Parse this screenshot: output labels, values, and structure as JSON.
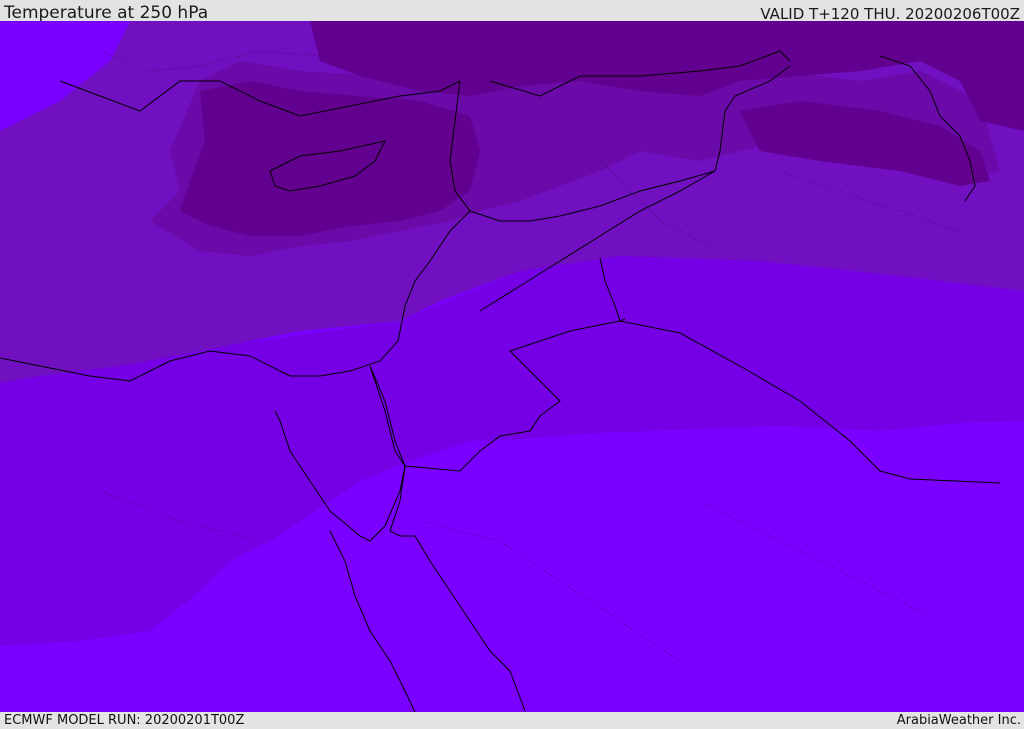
{
  "header": {
    "title": "Temperature at 250 hPa",
    "valid_time": "VALID T+120 THU. 20200206T00Z"
  },
  "footer": {
    "model_run": "ECMWF MODEL RUN: 20200201T00Z",
    "credit": "ArabiaWeather Inc."
  },
  "colors": {
    "band_warmest": "#7a00ff",
    "band_warm": "#7500e6",
    "band_mid": "#7010c0",
    "band_cool": "#6a0aa8",
    "band_cold": "#62008f",
    "coastline": "#000000",
    "border": "#000000",
    "header_background": "#e3e3e3"
  }
}
